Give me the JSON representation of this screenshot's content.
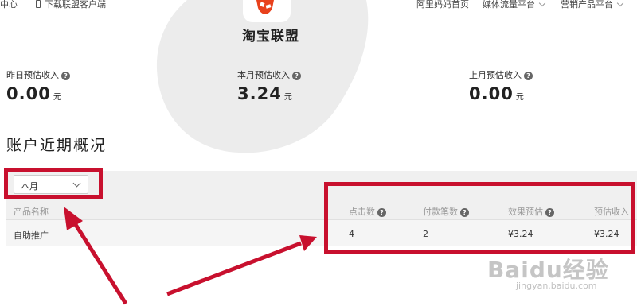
{
  "topbar": {
    "left_link": "中心",
    "download_label": "下载联盟客户端",
    "nav_home": "阿里妈妈首页",
    "nav_media": "媒体流量平台",
    "nav_marketing": "营销产品平台"
  },
  "logo": {
    "text": "淘宝联盟",
    "brand_color": "#e8411c"
  },
  "stats": [
    {
      "label": "昨日预估收入",
      "value": "0.00",
      "unit": "元"
    },
    {
      "label": "本月预估收入",
      "value": "3.24",
      "unit": "元"
    },
    {
      "label": "上月预估收入",
      "value": "0.00",
      "unit": "元"
    }
  ],
  "section_title": "账户近期概况",
  "period_select": {
    "value": "本月"
  },
  "table": {
    "headers": [
      "产品名称",
      "点击数",
      "付款笔数",
      "效果预估",
      "预估收入"
    ],
    "rows": [
      [
        "自助推广",
        "4",
        "2",
        "¥3.24",
        "¥3.24"
      ]
    ]
  },
  "annotation_color": "#c8102e",
  "watermark": {
    "text": "Baidu经验",
    "sub": "jingyan.baidu.com"
  }
}
